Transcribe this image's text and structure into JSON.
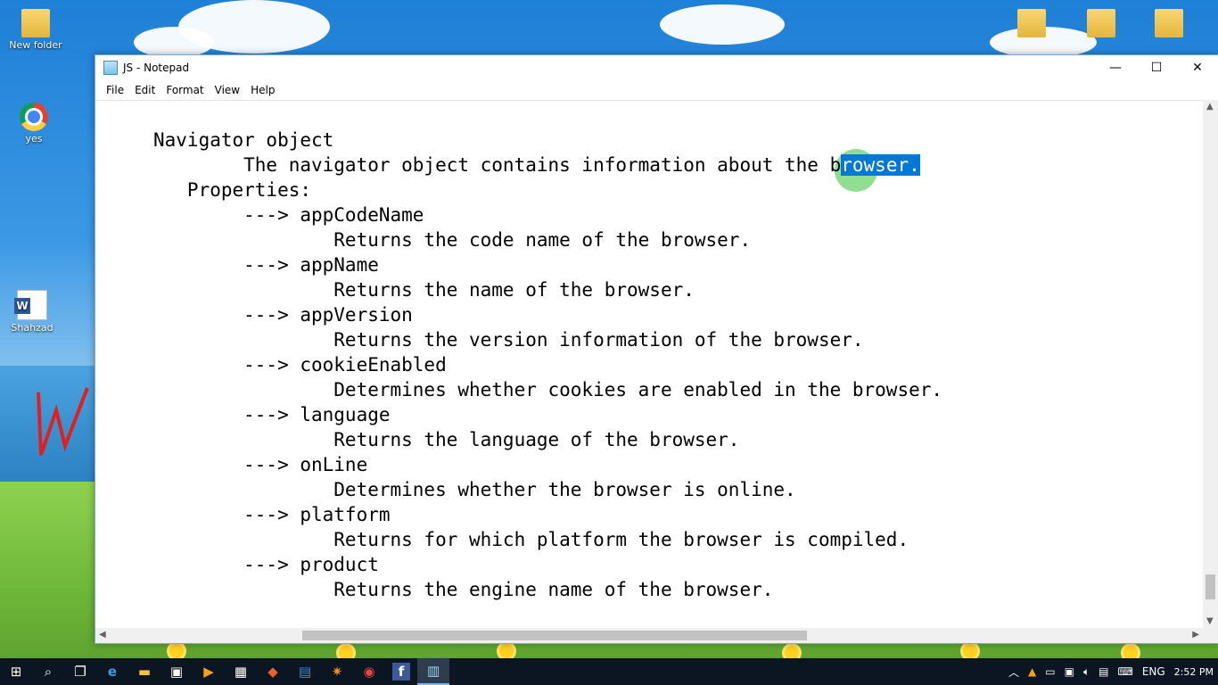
{
  "desktop": {
    "icons": [
      {
        "label": "New folder"
      },
      {
        "label": "yes"
      },
      {
        "label": "Shahzad"
      }
    ]
  },
  "window": {
    "title": "JS - Notepad",
    "controls": {
      "minimize": "—",
      "maximize": "☐",
      "close": "✕"
    },
    "menu": [
      "File",
      "Edit",
      "Format",
      "View",
      "Help"
    ]
  },
  "editor": {
    "lines": [
      "Navigator object",
      "        The navigator object contains information about the ",
      "   Properties:",
      "        ---> appCodeName",
      "                Returns the code name of the browser.",
      "        ---> appName",
      "                Returns the name of the browser.",
      "        ---> appVersion",
      "                Returns the version information of the browser.",
      "        ---> cookieEnabled",
      "                Determines whether cookies are enabled in the browser.",
      "        ---> language",
      "                Returns the language of the browser.",
      "        ---> onLine",
      "                Determines whether the browser is online.",
      "        ---> platform",
      "                Returns for which platform the browser is compiled.",
      "        ---> product",
      "                Returns the engine name of the browser."
    ],
    "line2_unselected_tail": "b",
    "selected_text": "rowser."
  },
  "taskbar": {
    "language": "ENG",
    "time": "2:52 PM"
  }
}
